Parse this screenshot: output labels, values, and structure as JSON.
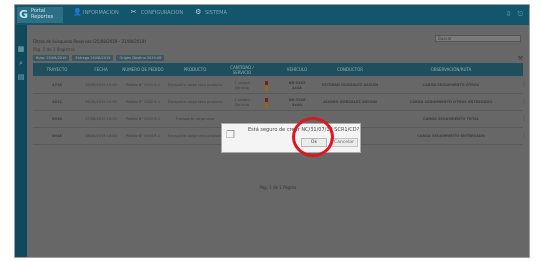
{
  "app": {
    "logo_text": "Portal Reportes",
    "nav": [
      {
        "icon": "user-icon",
        "glyph": "👤",
        "label": "INFORMACION"
      },
      {
        "icon": "tools-icon",
        "glyph": "✂",
        "label": "CONFIGURACION"
      },
      {
        "icon": "gear-icon",
        "glyph": "⚙",
        "label": "SISTEMA"
      }
    ],
    "top_right_icons": [
      "⇩",
      "⎋"
    ]
  },
  "filters": {
    "title": "Filtros de búsqueda  Reservas (25/08/2019 - 31/08/2019)",
    "pager_top": "Pág. 1 de 1 Registros",
    "search_placeholder": "Buscar",
    "chips": [
      "Ruta: 25/08/2019",
      "Entrega 25/08/2019",
      "Origen Destino 2019-08"
    ]
  },
  "table": {
    "headers": [
      "TRAYECTO",
      "FECHA",
      "NÚMERO DE PEDIDO",
      "PRODUCTO",
      "CANTIDAD / SERVICIO",
      "",
      "VEHÍCULO",
      "CONDUCTOR",
      "OBSERVACIÓN/RUTA"
    ],
    "rows": [
      {
        "c0": "4718",
        "c1": "25/08/2019 10:00",
        "c2": "Pedido N° 0001 R-1",
        "c3": "Transporte carga seca producto",
        "c4a": "1 unidad",
        "c4b": "Servicio",
        "c6a": "NB-3345",
        "c6b": "4x4A",
        "c7": "ESTEBAN GONZALEZ ASSIGN",
        "c8": "CARGA SEGUIMIENTO OTROS"
      },
      {
        "c0": "4812",
        "c1": "26/08/2019 10:00",
        "c2": "Pedido N° 0002 R-1",
        "c3": "Transporte carga seca producto",
        "c4a": "1 unidad",
        "c4b": "Servicio",
        "c6a": "NB-3346",
        "c6b": "4x4A",
        "c7": "ALVARO GONZALEZ ASSIGN",
        "c8": "CARGA SEGUIMIENTO OTROS ENTREGADO"
      },
      {
        "c0": "8938",
        "c1": "27/08/2019 10:00",
        "c2": "Pedido N° 0003 R-1",
        "c3": "Transporte carga seca",
        "c4a": "",
        "c4b": "",
        "c6a": "",
        "c6b": "",
        "c7": "",
        "c8": "CARGA SEGUIMIENTO TOTAL"
      },
      {
        "c0": "8948",
        "c1": "28/08/2019 10:00",
        "c2": "Pedido N° 0004 R-1",
        "c3": "Transporte carga seca producto",
        "c4a": "1 unidad",
        "c4b": "Servicio",
        "c6a": "NB-3347",
        "c6b": "4x4A",
        "c7": "",
        "c8": "CARGA SEGUIMIENTO ENTREGADO"
      }
    ],
    "pager_bottom": "Pág. 1 de 1 Página"
  },
  "dialog": {
    "message": "Está seguro de crear NC/31/07/19 SCR1/CD?",
    "ok_label": "Ok",
    "cancel_label": "Cancelar"
  },
  "colors": {
    "annotation": "#e0151f",
    "topbar": "#13556a"
  }
}
